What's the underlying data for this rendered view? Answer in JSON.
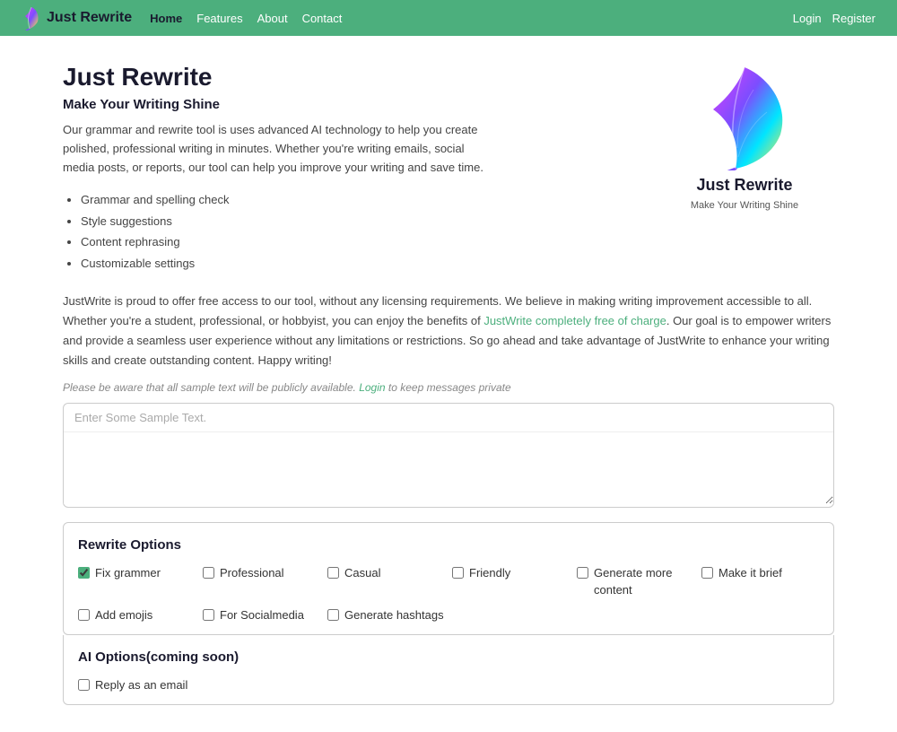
{
  "navbar": {
    "brand": "Just Rewrite",
    "links": [
      {
        "label": "Home",
        "active": true,
        "href": "#"
      },
      {
        "label": "Features",
        "active": false,
        "href": "#"
      },
      {
        "label": "About",
        "active": false,
        "href": "#"
      },
      {
        "label": "Contact",
        "active": false,
        "href": "#"
      }
    ],
    "login": "Login",
    "register": "Register"
  },
  "hero": {
    "title": "Just Rewrite",
    "subtitle": "Make Your Writing Shine",
    "description": "Our grammar and rewrite tool is uses advanced AI technology to help you create polished, professional writing in minutes. Whether you're writing emails, social media posts, or reports, our tool can help you improve your writing and save time.",
    "features": [
      "Grammar and spelling check",
      "Style suggestions",
      "Content rephrasing",
      "Customizable settings"
    ]
  },
  "logo": {
    "brand": "Just Rewrite",
    "tagline": "Make Your Writing Shine"
  },
  "info_paragraph": "JustWrite is proud to offer free access to our tool, without any licensing requirements. We believe in making writing improvement accessible to all. Whether you're a student, professional, or hobbyist, you can enjoy the benefits of JustWrite completely free of charge. Our goal is to empower writers and provide a seamless user experience without any limitations or restrictions. So go ahead and take advantage of JustWrite to enhance your writing skills and create outstanding content. Happy writing!",
  "free_link_text": "JustWrite completely free of charge",
  "public_notice_before": "Please be aware that all sample text will be publicly available.",
  "public_notice_link": "Login",
  "public_notice_after": "to keep messages private",
  "textarea": {
    "placeholder": "Enter Some Sample Text."
  },
  "rewrite_options": {
    "title": "Rewrite Options",
    "row1": [
      {
        "label": "Fix grammer",
        "checked": true
      },
      {
        "label": "Professional",
        "checked": false
      },
      {
        "label": "Casual",
        "checked": false
      },
      {
        "label": "Friendly",
        "checked": false
      },
      {
        "label": "Generate more content",
        "checked": false
      },
      {
        "label": "Make it brief",
        "checked": false
      }
    ],
    "row2": [
      {
        "label": "Add emojis",
        "checked": false
      },
      {
        "label": "For Socialmedia",
        "checked": false
      },
      {
        "label": "Generate hashtags",
        "checked": false
      }
    ]
  },
  "ai_options": {
    "title": "AI Options(coming soon)",
    "items": [
      {
        "label": "Reply as an email",
        "checked": false
      }
    ]
  },
  "colors": {
    "green": "#4caf7d",
    "dark_navy": "#1a1a2e"
  }
}
